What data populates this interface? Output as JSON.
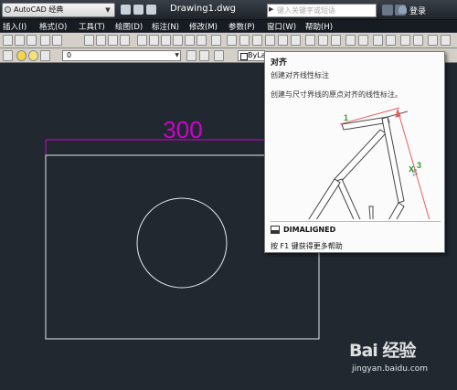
{
  "titlebar": {
    "workspace": "AutoCAD 经典",
    "document_title": "Drawing1.dwg",
    "search_placeholder": "键入关键字或短语",
    "login_label": "登录"
  },
  "menubar": {
    "items": [
      {
        "label": "插入(I)"
      },
      {
        "label": "格式(O)"
      },
      {
        "label": "工具(T)"
      },
      {
        "label": "绘图(D)"
      },
      {
        "label": "标注(N)"
      },
      {
        "label": "修改(M)"
      },
      {
        "label": "参数(P)"
      },
      {
        "label": "窗口(W)"
      },
      {
        "label": "帮助(H)"
      }
    ]
  },
  "layerbar": {
    "current_layer": "0",
    "linetype": "ByLay"
  },
  "drawing": {
    "dimension_text": "300",
    "dimension_color": "#d000d0",
    "geometry_color": "#e8e8e8"
  },
  "tooltip": {
    "title": "对齐",
    "subtitle": "创建对齐线性标注",
    "description": "创建与尺寸界线的原点对齐的线性标注。",
    "figure_labels": [
      "1",
      "2",
      "3"
    ],
    "command_name": "DIMALIGNED",
    "help_text": "按 F1 键获得更多帮助"
  },
  "watermark": {
    "logo_text": "Bai 经验",
    "url": "jingyan.baidu.com"
  }
}
